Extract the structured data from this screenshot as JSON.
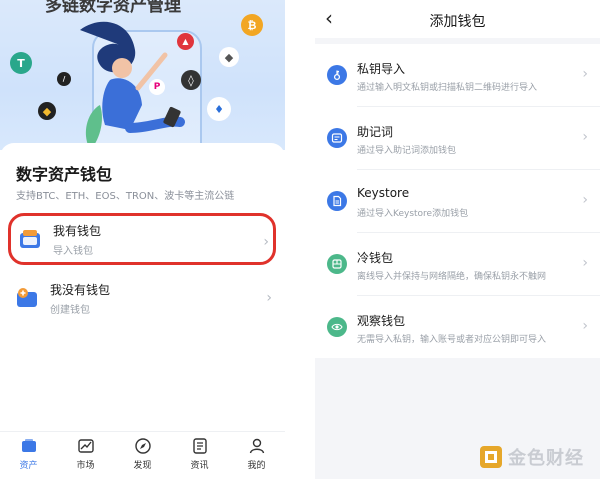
{
  "left": {
    "hero_title": "多链数字资产管理",
    "card": {
      "title": "数字资产钱包",
      "subtitle": "支持BTC、ETH、EOS、TRON、波卡等主流公链"
    },
    "options": [
      {
        "title": "我有钱包",
        "subtitle": "导入钱包",
        "icon": "wallet-import-icon",
        "highlighted": true
      },
      {
        "title": "我没有钱包",
        "subtitle": "创建钱包",
        "icon": "wallet-create-icon",
        "highlighted": false
      }
    ],
    "tabs": [
      {
        "label": "资产",
        "icon": "wallet-icon",
        "active": true
      },
      {
        "label": "市场",
        "icon": "chart-icon",
        "active": false
      },
      {
        "label": "发现",
        "icon": "compass-icon",
        "active": false
      },
      {
        "label": "资讯",
        "icon": "news-icon",
        "active": false
      },
      {
        "label": "我的",
        "icon": "user-icon",
        "active": false
      }
    ],
    "coin_glyphs": {
      "btc": "₿",
      "eth": "◆",
      "tron": "▲",
      "dot": "P"
    }
  },
  "right": {
    "nav": {
      "back": "‹",
      "title": "添加钱包"
    },
    "rows": [
      {
        "title": "私钥导入",
        "subtitle": "通过输入明文私钥或扫描私钥二维码进行导入",
        "icon": "key-icon",
        "color": "#3c78e6"
      },
      {
        "title": "助记词",
        "subtitle": "通过导入助记词添加钱包",
        "icon": "mnemonic-icon",
        "color": "#3c78e6"
      },
      {
        "title": "Keystore",
        "subtitle": "通过导入Keystore添加钱包",
        "icon": "keystore-file-icon",
        "color": "#3c78e6"
      },
      {
        "title": "冷钱包",
        "subtitle": "离线导入并保持与网络隔绝，确保私钥永不触网",
        "icon": "cold-wallet-icon",
        "color": "#4cb88a"
      },
      {
        "title": "观察钱包",
        "subtitle": "无需导入私钥，输入账号或者对应公钥即可导入",
        "icon": "eye-icon",
        "color": "#4cb88a"
      }
    ]
  },
  "watermark": {
    "text": "金色财经"
  },
  "colors": {
    "accent": "#3c78e6",
    "highlight_border": "#e0322b",
    "green": "#4cb88a"
  },
  "chevron": "›"
}
